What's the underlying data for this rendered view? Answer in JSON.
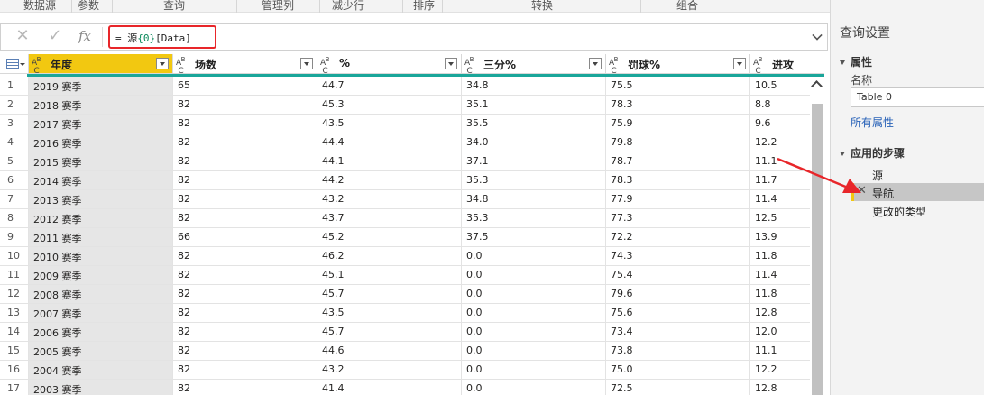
{
  "ribbon": {
    "groups": [
      "数据源",
      "参数",
      "查询",
      "管理列",
      "减少行",
      "排序",
      "转换",
      "组合"
    ]
  },
  "formula": {
    "cancel_icon": "close-icon",
    "commit_icon": "check-icon",
    "fx": "fx",
    "prefix": "= 源",
    "index": "{0}",
    "suffix": "[Data]"
  },
  "table": {
    "columns": [
      "年度",
      "场数",
      "%",
      "三分%",
      "罚球%",
      "进攻"
    ],
    "rows": [
      [
        "1",
        "2019 赛季",
        "65",
        "44.7",
        "34.8",
        "75.5",
        "10.5"
      ],
      [
        "2",
        "2018 赛季",
        "82",
        "45.3",
        "35.1",
        "78.3",
        "8.8"
      ],
      [
        "3",
        "2017 赛季",
        "82",
        "43.5",
        "35.5",
        "75.9",
        "9.6"
      ],
      [
        "4",
        "2016 赛季",
        "82",
        "44.4",
        "34.0",
        "79.8",
        "12.2"
      ],
      [
        "5",
        "2015 赛季",
        "82",
        "44.1",
        "37.1",
        "78.7",
        "11.1"
      ],
      [
        "6",
        "2014 赛季",
        "82",
        "44.2",
        "35.3",
        "78.3",
        "11.7"
      ],
      [
        "7",
        "2013 赛季",
        "82",
        "43.2",
        "34.8",
        "77.9",
        "11.4"
      ],
      [
        "8",
        "2012 赛季",
        "82",
        "43.7",
        "35.3",
        "77.3",
        "12.5"
      ],
      [
        "9",
        "2011 赛季",
        "66",
        "45.2",
        "37.5",
        "72.2",
        "13.9"
      ],
      [
        "10",
        "2010 赛季",
        "82",
        "46.2",
        "0.0",
        "74.3",
        "11.8"
      ],
      [
        "11",
        "2009 赛季",
        "82",
        "45.1",
        "0.0",
        "75.4",
        "11.4"
      ],
      [
        "12",
        "2008 赛季",
        "82",
        "45.7",
        "0.0",
        "79.6",
        "11.8"
      ],
      [
        "13",
        "2007 赛季",
        "82",
        "43.5",
        "0.0",
        "75.6",
        "12.8"
      ],
      [
        "14",
        "2006 赛季",
        "82",
        "45.7",
        "0.0",
        "73.4",
        "12.0"
      ],
      [
        "15",
        "2005 赛季",
        "82",
        "44.6",
        "0.0",
        "73.8",
        "11.1"
      ],
      [
        "16",
        "2004 赛季",
        "82",
        "43.2",
        "0.0",
        "75.0",
        "12.2"
      ],
      [
        "17",
        "2003 赛季",
        "82",
        "41.4",
        "0.0",
        "72.5",
        "12.8"
      ]
    ]
  },
  "panel": {
    "title": "查询设置",
    "properties_header": "属性",
    "name_label": "名称",
    "name_value": "Table 0",
    "all_properties_link": "所有属性",
    "steps_header": "应用的步骤",
    "steps": [
      "源",
      "导航",
      "更改的类型"
    ]
  },
  "colors": {
    "accent": "#f2c811",
    "teal": "#1aa69a",
    "highlight": "#e8262a",
    "link": "#2a63b8"
  }
}
